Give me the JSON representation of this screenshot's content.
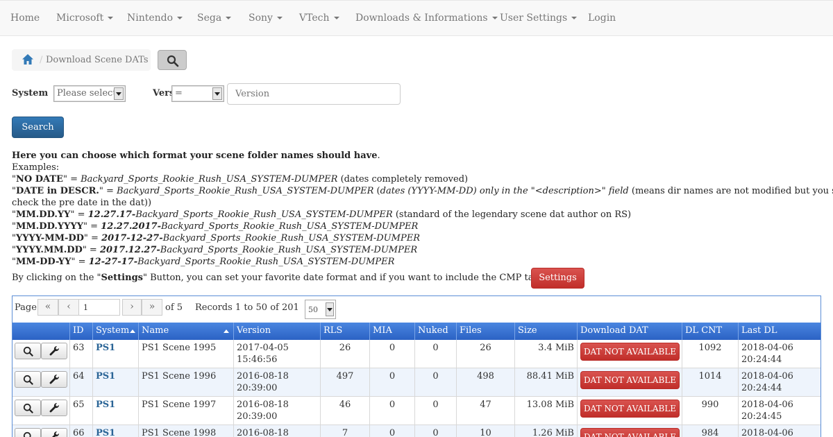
{
  "nav": {
    "home": "Home",
    "microsoft": "Microsoft",
    "nintendo": "Nintendo",
    "sega": "Sega",
    "sony": "Sony",
    "vtech": "VTech",
    "downloads": "Downloads & Informations",
    "user_settings": "User Settings",
    "login": "Login"
  },
  "breadcrumb": {
    "sep": "/",
    "current": "Download Scene DATs"
  },
  "filters": {
    "system_label": "System",
    "system_value": "Please select",
    "version_label": "Version",
    "version_op": "=",
    "version_placeholder": "Version",
    "search_button": "Search"
  },
  "info": {
    "intro_bold": "Here you can choose which format your scene folder names should have",
    "intro_end": ".",
    "examples": "Examples:",
    "l1_q1": "\"",
    "l1_key": "NO DATE",
    "l1_q2": "\" = ",
    "l1_val": "Backyard_Sports_Rookie_Rush_USA_SYSTEM-DUMPER",
    "l1_note": " (dates completely removed)",
    "l2_q1": "\"",
    "l2_key": "DATE in DESCR.",
    "l2_q2": "\" = ",
    "l2_val": "Backyard_Sports_Rookie_Rush_USA_SYSTEM-DUMPER",
    "l2_note_a": " (",
    "l2_note_b": "dates (YYYY-MM-DD) only in the \"<description>\" field",
    "l2_note_c": " (means dir names are not modified but you still can",
    "l2_cont": "check the pre date in the dat))",
    "l3_key": "MM.DD.YY",
    "l3_date": "12.27.17-",
    "l3_val": "Backyard_Sports_Rookie_Rush_USA_SYSTEM-DUMPER",
    "l3_note": " (standard of the legendary scene dat author on RS)",
    "l4_key": "MM.DD.YYYY",
    "l4_date": "12.27.2017-",
    "l4_val": "Backyard_Sports_Rookie_Rush_USA_SYSTEM-DUMPER",
    "l5_key": "YYYY-MM-DD",
    "l5_date": "2017-12-27-",
    "l5_val": "Backyard_Sports_Rookie_Rush_USA_SYSTEM-DUMPER",
    "l6_key": "YYYY.MM.DD",
    "l6_date": "2017.12.27-",
    "l6_val": "Backyard_Sports_Rookie_Rush_USA_SYSTEM-DUMPER",
    "l7_key": "MM-DD-YY",
    "l7_date": "12-27-17-",
    "l7_val": "Backyard_Sports_Rookie_Rush_USA_SYSTEM-DUMPER",
    "settings_a": "By clicking on the \"",
    "settings_b": "Settings",
    "settings_c": "\" Button, you can set your favorite date format and if you want to include the CMP tag or not.",
    "settings_button": "Settings"
  },
  "pager": {
    "page_label": "Page",
    "current_page": "1",
    "of_label": "of 5",
    "records": "Records 1 to 50 of 201",
    "rows_per_page": "50"
  },
  "table": {
    "columns": [
      "",
      "ID",
      "System",
      "Name",
      "Version",
      "RLS",
      "MIA",
      "Nuked",
      "Files",
      "Size",
      "Download DAT",
      "DL CNT",
      "Last DL"
    ],
    "rows": [
      {
        "id": "63",
        "system": "PS1",
        "name": "PS1 Scene 1995",
        "version_date": "2017-04-05",
        "version_time": "15:46:56",
        "rls": "26",
        "mia": "0",
        "nuked": "0",
        "files": "26",
        "size": "3.4 MiB",
        "dat": "DAT NOT AVAILABLE",
        "dl_cnt": "1092",
        "last_date": "2018-04-06",
        "last_time": "20:24:44"
      },
      {
        "id": "64",
        "system": "PS1",
        "name": "PS1 Scene 1996",
        "version_date": "2016-08-18",
        "version_time": "20:39:00",
        "rls": "497",
        "mia": "0",
        "nuked": "0",
        "files": "498",
        "size": "88.41 MiB",
        "dat": "DAT NOT AVAILABLE",
        "dl_cnt": "1014",
        "last_date": "2018-04-06",
        "last_time": "20:24:44"
      },
      {
        "id": "65",
        "system": "PS1",
        "name": "PS1 Scene 1997",
        "version_date": "2016-08-18",
        "version_time": "20:39:00",
        "rls": "46",
        "mia": "0",
        "nuked": "0",
        "files": "47",
        "size": "13.08 MiB",
        "dat": "DAT NOT AVAILABLE",
        "dl_cnt": "990",
        "last_date": "2018-04-06",
        "last_time": "20:24:45"
      },
      {
        "id": "66",
        "system": "PS1",
        "name": "PS1 Scene 1998",
        "version_date": "2016-08-18",
        "version_time": "",
        "rls": "7",
        "mia": "0",
        "nuked": "0",
        "files": "10",
        "size": "1.26 MiB",
        "dat": "DAT NOT AVAILABLE",
        "dl_cnt": "984",
        "last_date": "2018-04-06",
        "last_time": ""
      }
    ]
  },
  "icons": {
    "home": "home-icon",
    "search": "magnifier-icon",
    "view": "magnifier-icon",
    "edit": "wrench-icon"
  },
  "colors": {
    "primary": "#337ab7",
    "danger": "#d9534f",
    "header": "#3a74d2",
    "link": "#2a6496"
  }
}
